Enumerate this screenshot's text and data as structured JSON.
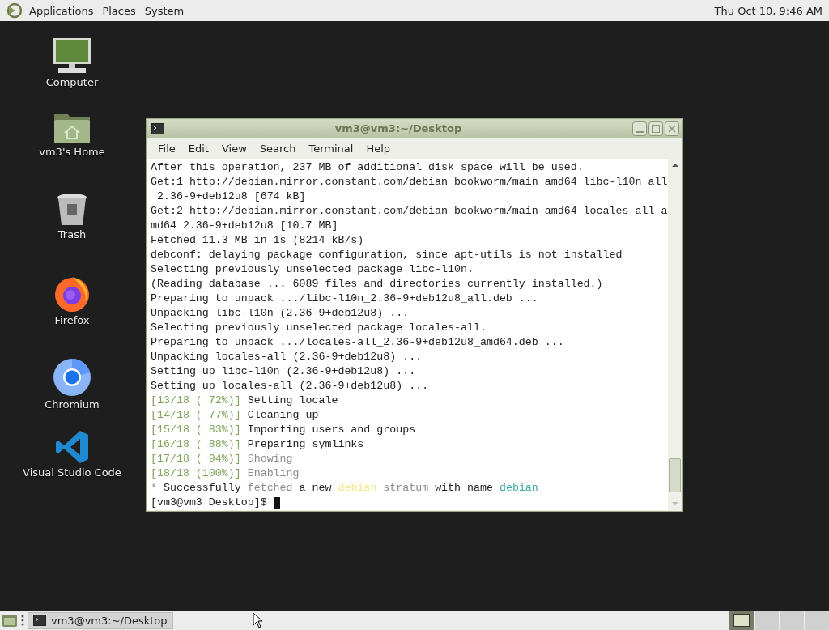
{
  "top_panel": {
    "menus": [
      "Applications",
      "Places",
      "System"
    ],
    "clock": "Thu Oct 10,  9:46 AM"
  },
  "desktop_icons": [
    {
      "kind": "computer",
      "label": "Computer"
    },
    {
      "kind": "home",
      "label": "vm3's Home"
    },
    {
      "kind": "trash",
      "label": "Trash"
    },
    {
      "kind": "firefox",
      "label": "Firefox"
    },
    {
      "kind": "chromium",
      "label": "Chromium"
    },
    {
      "kind": "vscode",
      "label": "Visual Studio Code"
    }
  ],
  "terminal": {
    "title": "vm3@vm3:~/Desktop",
    "menus": [
      "File",
      "Edit",
      "View",
      "Search",
      "Terminal",
      "Help"
    ],
    "lines": [
      [
        {
          "kind": "plain",
          "text": "After this operation, 237 MB of additional disk space will be used."
        }
      ],
      [
        {
          "kind": "plain",
          "text": "Get:1 http://debian.mirror.constant.com/debian bookworm/main amd64 libc-l10n all"
        }
      ],
      [
        {
          "kind": "plain",
          "text": " 2.36-9+deb12u8 [674 kB]"
        }
      ],
      [
        {
          "kind": "plain",
          "text": "Get:2 http://debian.mirror.constant.com/debian bookworm/main amd64 locales-all a"
        }
      ],
      [
        {
          "kind": "plain",
          "text": "md64 2.36-9+deb12u8 [10.7 MB]"
        }
      ],
      [
        {
          "kind": "plain",
          "text": "Fetched 11.3 MB in 1s (8214 kB/s)"
        }
      ],
      [
        {
          "kind": "plain",
          "text": "debconf: delaying package configuration, since apt-utils is not installed"
        }
      ],
      [
        {
          "kind": "plain",
          "text": "Selecting previously unselected package libc-l10n."
        }
      ],
      [
        {
          "kind": "plain",
          "text": "(Reading database ... 6089 files and directories currently installed.)"
        }
      ],
      [
        {
          "kind": "plain",
          "text": "Preparing to unpack .../libc-l10n_2.36-9+deb12u8_all.deb ..."
        }
      ],
      [
        {
          "kind": "plain",
          "text": "Unpacking libc-l10n (2.36-9+deb12u8) ..."
        }
      ],
      [
        {
          "kind": "plain",
          "text": "Selecting previously unselected package locales-all."
        }
      ],
      [
        {
          "kind": "plain",
          "text": "Preparing to unpack .../locales-all_2.36-9+deb12u8_amd64.deb ..."
        }
      ],
      [
        {
          "kind": "plain",
          "text": "Unpacking locales-all (2.36-9+deb12u8) ..."
        }
      ],
      [
        {
          "kind": "plain",
          "text": "Setting up libc-l10n (2.36-9+deb12u8) ..."
        }
      ],
      [
        {
          "kind": "plain",
          "text": "Setting up locales-all (2.36-9+deb12u8) ..."
        }
      ],
      [
        {
          "kind": "green",
          "text": "[13/18 ( 72%)]"
        },
        {
          "kind": "plain",
          "text": " Setting locale"
        }
      ],
      [
        {
          "kind": "green",
          "text": "[14/18 ( 77%)]"
        },
        {
          "kind": "plain",
          "text": " Cleaning up"
        }
      ],
      [
        {
          "kind": "green",
          "text": "[15/18 ( 83%)]"
        },
        {
          "kind": "plain",
          "text": " Importing users and groups"
        }
      ],
      [
        {
          "kind": "green",
          "text": "[16/18 ( 88%)]"
        },
        {
          "kind": "plain",
          "text": " Preparing symlinks"
        }
      ],
      [
        {
          "kind": "green",
          "text": "[17/18 ( 94%)]"
        },
        {
          "kind": "dim",
          "text": " Showing"
        }
      ],
      [
        {
          "kind": "green",
          "text": "[18/18 (100%)]"
        },
        {
          "kind": "dim",
          "text": " Enabling"
        }
      ],
      [
        {
          "kind": "dim",
          "text": "*"
        },
        {
          "kind": "plain",
          "text": " Successfully "
        },
        {
          "kind": "dim",
          "text": "fetched"
        },
        {
          "kind": "plain",
          "text": " a new "
        },
        {
          "kind": "yellow",
          "text": "debian"
        },
        {
          "kind": "dim",
          "text": " stratum"
        },
        {
          "kind": "plain",
          "text": " with name "
        },
        {
          "kind": "cyan",
          "text": "debian"
        }
      ],
      [
        {
          "kind": "plain",
          "text": "[vm3@vm3 Desktop]$ "
        }
      ]
    ]
  },
  "taskbar": {
    "tasks": [
      {
        "label": "vm3@vm3:~/Desktop",
        "selected": false
      }
    ],
    "workspaces": [
      {
        "selected": true
      },
      {
        "selected": false
      },
      {
        "selected": false
      },
      {
        "selected": false
      }
    ]
  }
}
